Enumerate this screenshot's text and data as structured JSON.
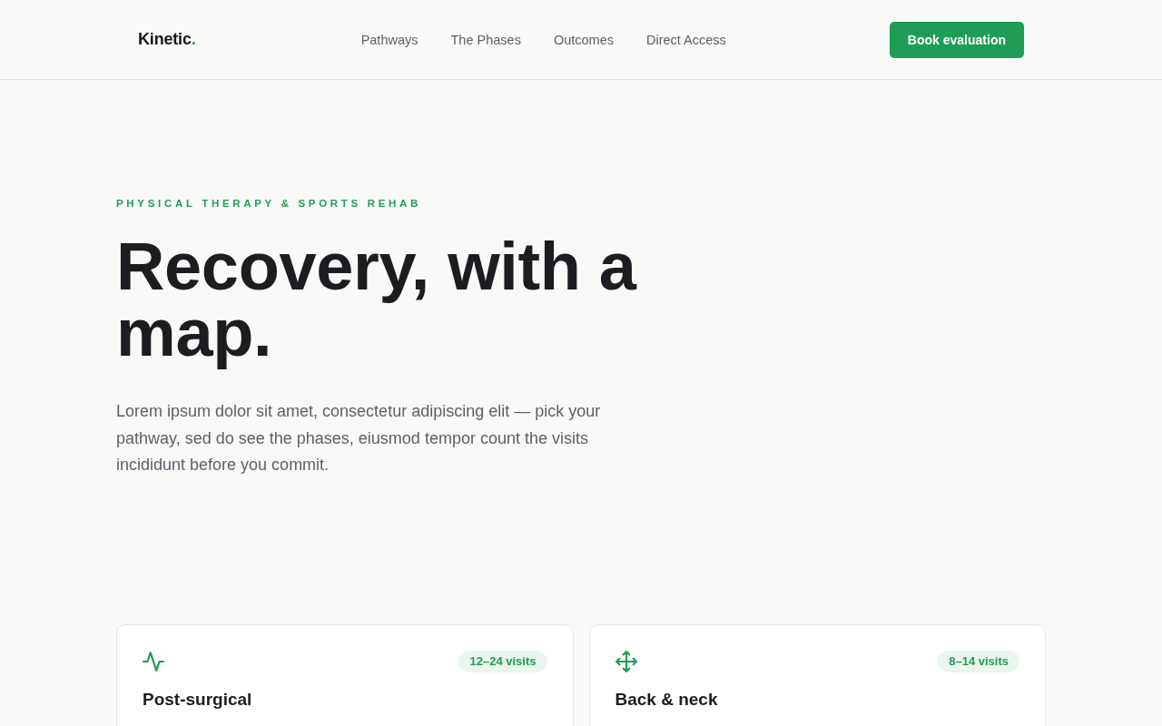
{
  "header": {
    "logo": {
      "text": "Kinetic",
      "mark": "."
    },
    "nav": [
      "Pathways",
      "The Phases",
      "Outcomes",
      "Direct Access"
    ],
    "cta": "Book evaluation"
  },
  "hero": {
    "eyebrow": "PHYSICAL THERAPY & SPORTS REHAB",
    "headline": "Recovery, with a map.",
    "lede": "Lorem ipsum dolor sit amet, consectetur adipiscing elit — pick your pathway, sed do see the phases, eiusmod tempor count the visits incididunt before you commit."
  },
  "pathways": [
    {
      "kind": "activity",
      "badge": "12–24 visits",
      "title": "Post-surgical"
    },
    {
      "kind": "move",
      "badge": "8–14 visits",
      "title": "Back & neck"
    }
  ]
}
